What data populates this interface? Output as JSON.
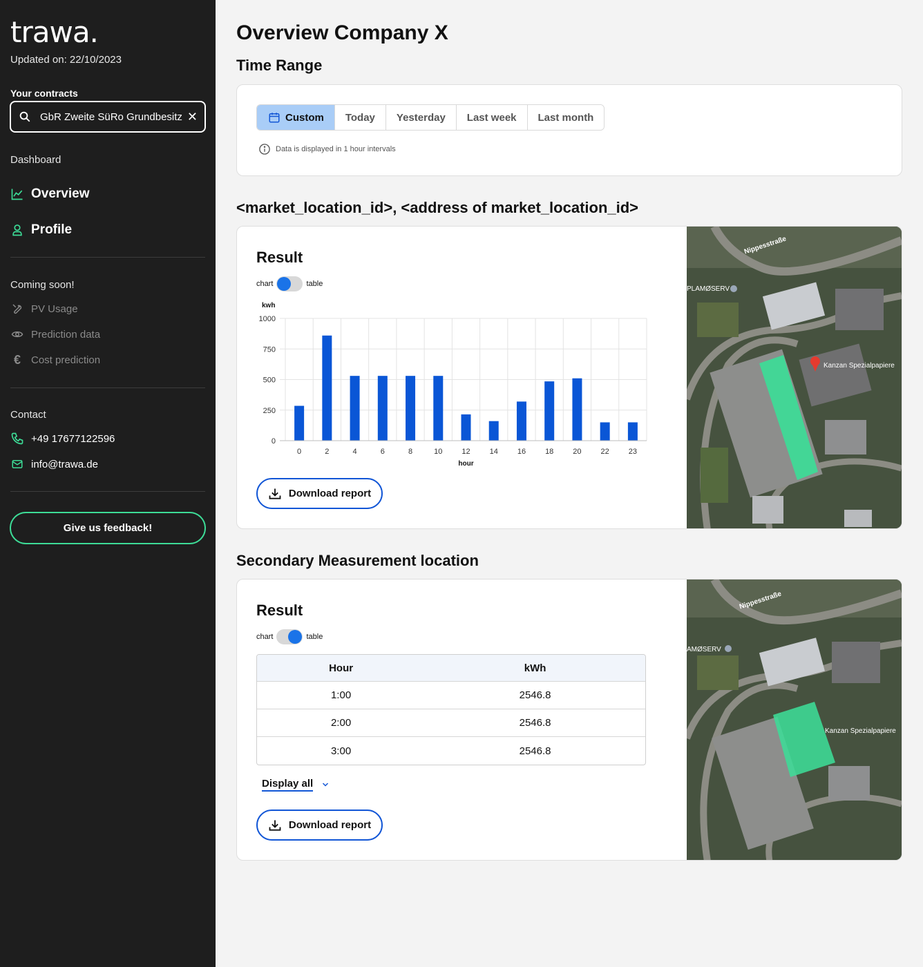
{
  "sidebar": {
    "logo": "trawa.",
    "updated": "Updated on: 22/10/2023",
    "contracts_label": "Your contracts",
    "contract_value": "GbR Zweite SüRo Grundbesitz",
    "dashboard_label": "Dashboard",
    "nav": [
      {
        "label": "Overview",
        "icon": "chart-line-icon"
      },
      {
        "label": "Profile",
        "icon": "user-icon"
      }
    ],
    "coming_soon_label": "Coming soon!",
    "coming_soon": [
      {
        "label": "PV Usage",
        "icon": "wrench-icon"
      },
      {
        "label": "Prediction data",
        "icon": "eye-icon"
      },
      {
        "label": "Cost prediction",
        "icon": "euro-icon"
      }
    ],
    "contact_label": "Contact",
    "phone": "+49 17677122596",
    "email": "info@trawa.de",
    "feedback": "Give us feedback!",
    "accent_color": "#3ddc97"
  },
  "main": {
    "title": "Overview Company X",
    "time_range_title": "Time Range",
    "tabs": [
      {
        "label": "Custom",
        "active": true
      },
      {
        "label": "Today"
      },
      {
        "label": "Yesterday"
      },
      {
        "label": "Last week"
      },
      {
        "label": "Last month"
      }
    ],
    "interval_note": "Data is displayed in 1 hour intervals",
    "location1_title": "<market_location_id>, <address of market_location_id>",
    "location2_title": "Secondary Measurement location",
    "result_label": "Result",
    "toggle_chart": "chart",
    "toggle_table": "table",
    "download": "Download report",
    "display_all": "Display all",
    "table": {
      "headers": [
        "Hour",
        "kWh"
      ],
      "rows": [
        [
          "1:00",
          "2546.8"
        ],
        [
          "2:00",
          "2546.8"
        ],
        [
          "3:00",
          "2546.8"
        ]
      ]
    },
    "map_labels": {
      "street": "Nippesstraße",
      "street2": "Nippesstraße",
      "poi1": "PLAMØSERV",
      "poi1b": "AMØSERV",
      "poi2": "Kanzan Spezialpapiere",
      "poi2b": "Kanzan Spezialpapiere"
    }
  },
  "chart_data": {
    "type": "bar",
    "ylabel": "kwh",
    "xlabel": "hour",
    "ylim": [
      0,
      1000
    ],
    "yticks": [
      0,
      250,
      500,
      750,
      1000
    ],
    "categories": [
      "0",
      "2",
      "4",
      "6",
      "8",
      "10",
      "12",
      "14",
      "16",
      "18",
      "20",
      "22",
      "23"
    ],
    "values": [
      285,
      860,
      530,
      530,
      530,
      530,
      215,
      160,
      320,
      485,
      510,
      150,
      150
    ],
    "bar_color": "#0a56d6",
    "grid": true
  }
}
